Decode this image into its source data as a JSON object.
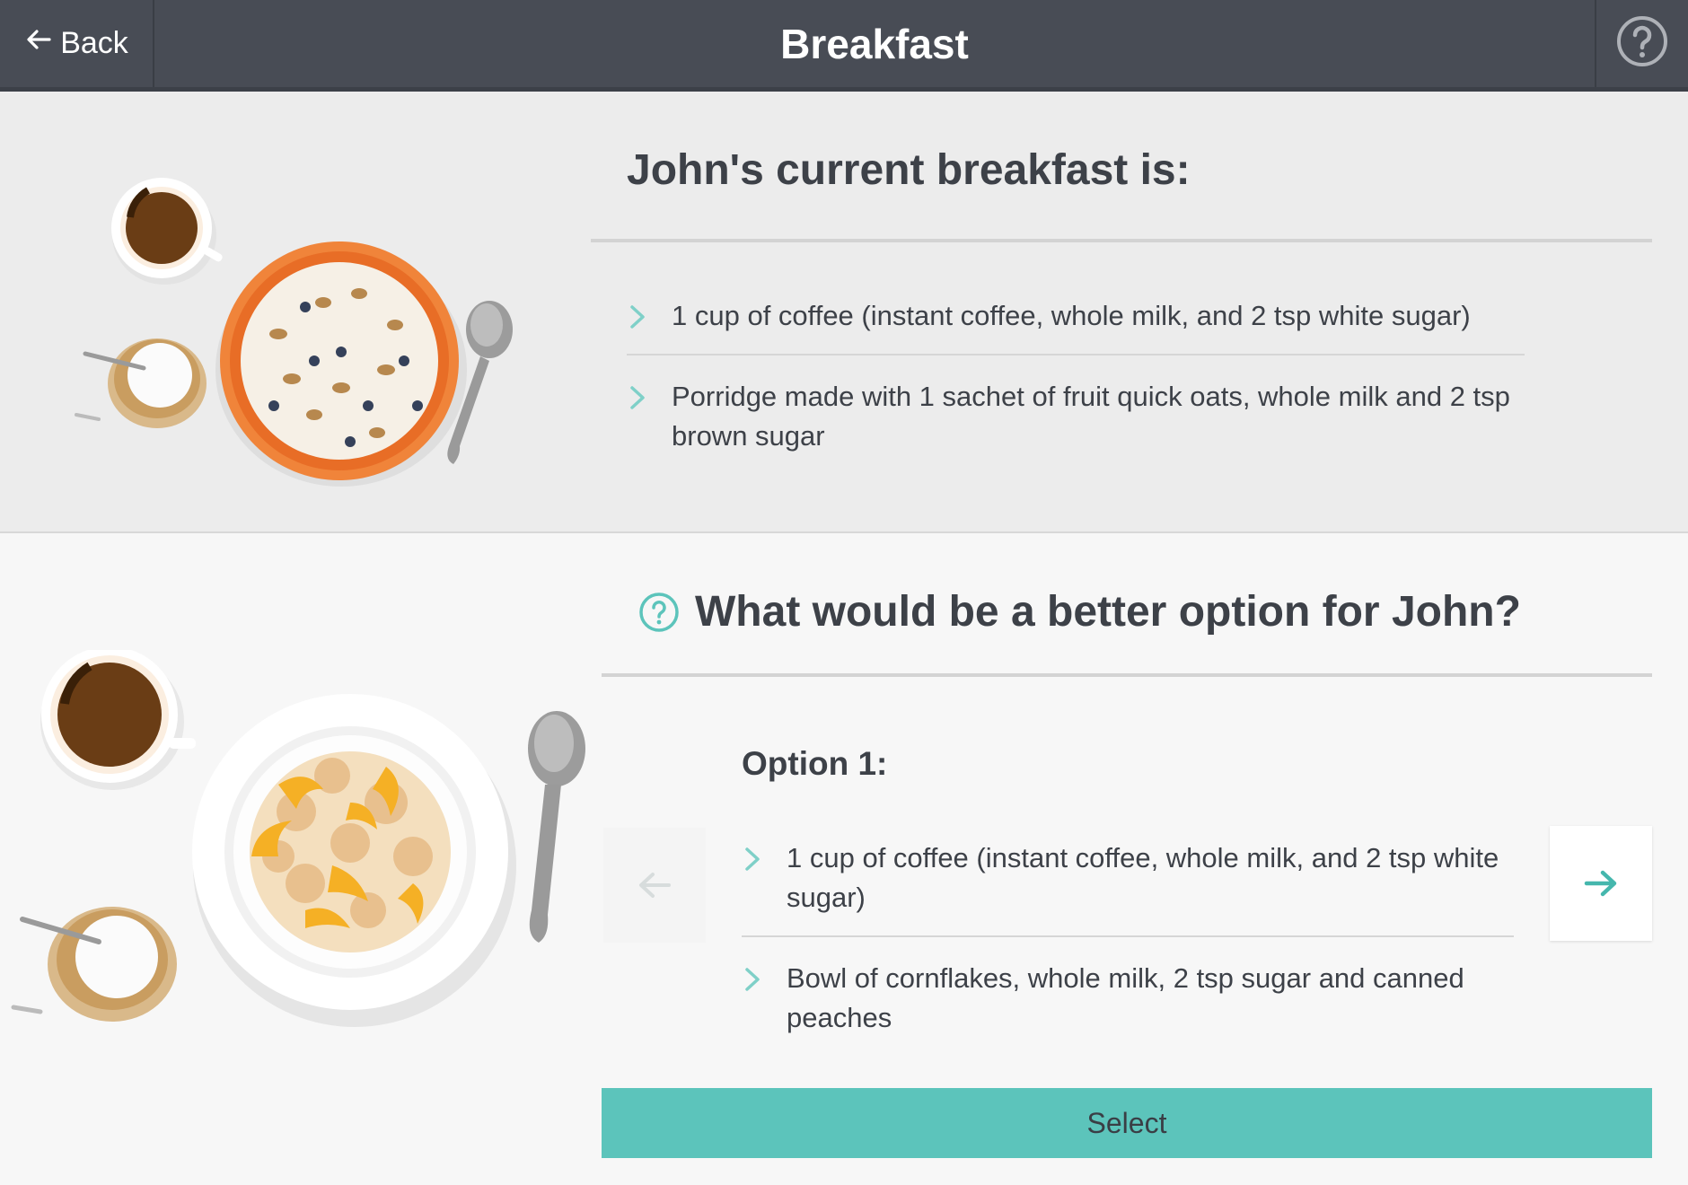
{
  "header": {
    "back_label": "Back",
    "title": "Breakfast"
  },
  "current": {
    "heading": "John's current breakfast is:",
    "items": [
      "1 cup of coffee (instant coffee, whole milk, and 2 tsp white sugar)",
      "Porridge made with 1 sachet of fruit quick oats, whole milk and 2 tsp brown sugar"
    ]
  },
  "better": {
    "heading": "What would be a better option for John?",
    "option_title": "Option 1:",
    "items": [
      "1 cup of coffee (instant coffee, whole milk, and 2 tsp white sugar)",
      "Bowl of cornflakes, whole milk, 2 tsp sugar and canned peaches"
    ],
    "select_label": "Select"
  },
  "colors": {
    "header_bg": "#484c55",
    "accent": "#5cc4bb",
    "text": "#3d4148"
  },
  "icons": {
    "back": "arrow-left-icon",
    "help": "question-circle-icon",
    "bullet": "chevron-right-icon",
    "prev": "arrow-left-icon",
    "next": "arrow-right-icon"
  }
}
